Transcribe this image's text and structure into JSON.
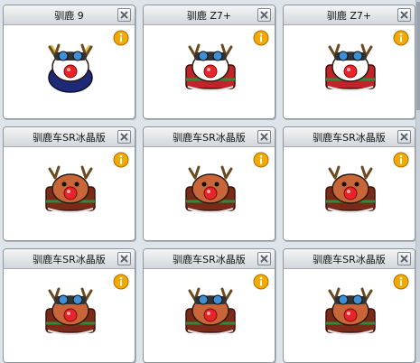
{
  "items": [
    {
      "title": "驯鹿 9",
      "art": "reindeer-blue",
      "icon": "reindeer-creature-icon"
    },
    {
      "title": "驯鹿 Z7+",
      "art": "reindeer-white",
      "icon": "reindeer-kart-icon"
    },
    {
      "title": "驯鹿 Z7+",
      "art": "reindeer-white",
      "icon": "reindeer-kart-icon"
    },
    {
      "title": "驯鹿车SR冰晶版",
      "art": "reindeer-red",
      "icon": "reindeer-sleigh-icon"
    },
    {
      "title": "驯鹿车SR冰晶版",
      "art": "reindeer-red",
      "icon": "reindeer-sleigh-icon"
    },
    {
      "title": "驯鹿车SR冰晶版",
      "art": "reindeer-red",
      "icon": "reindeer-sleigh-icon"
    },
    {
      "title": "驯鹿车SR冰晶版",
      "art": "reindeer-red-goggles",
      "icon": "reindeer-sleigh-icon"
    },
    {
      "title": "驯鹿车SR冰晶版",
      "art": "reindeer-red-goggles",
      "icon": "reindeer-sleigh-icon"
    },
    {
      "title": "驯鹿车SR冰晶版",
      "art": "reindeer-red-goggles",
      "icon": "reindeer-sleigh-icon"
    }
  ],
  "icons": {
    "close": "close-icon",
    "info": "info-icon"
  },
  "colors": {
    "info_fill": "#f2a900",
    "info_border": "#b06e00",
    "nose": "#e8242a",
    "body_red": "#b8502a",
    "body_white": "#f4f4f4",
    "body_navy": "#1e2a78",
    "goggle_blue": "#3f8fd6"
  }
}
